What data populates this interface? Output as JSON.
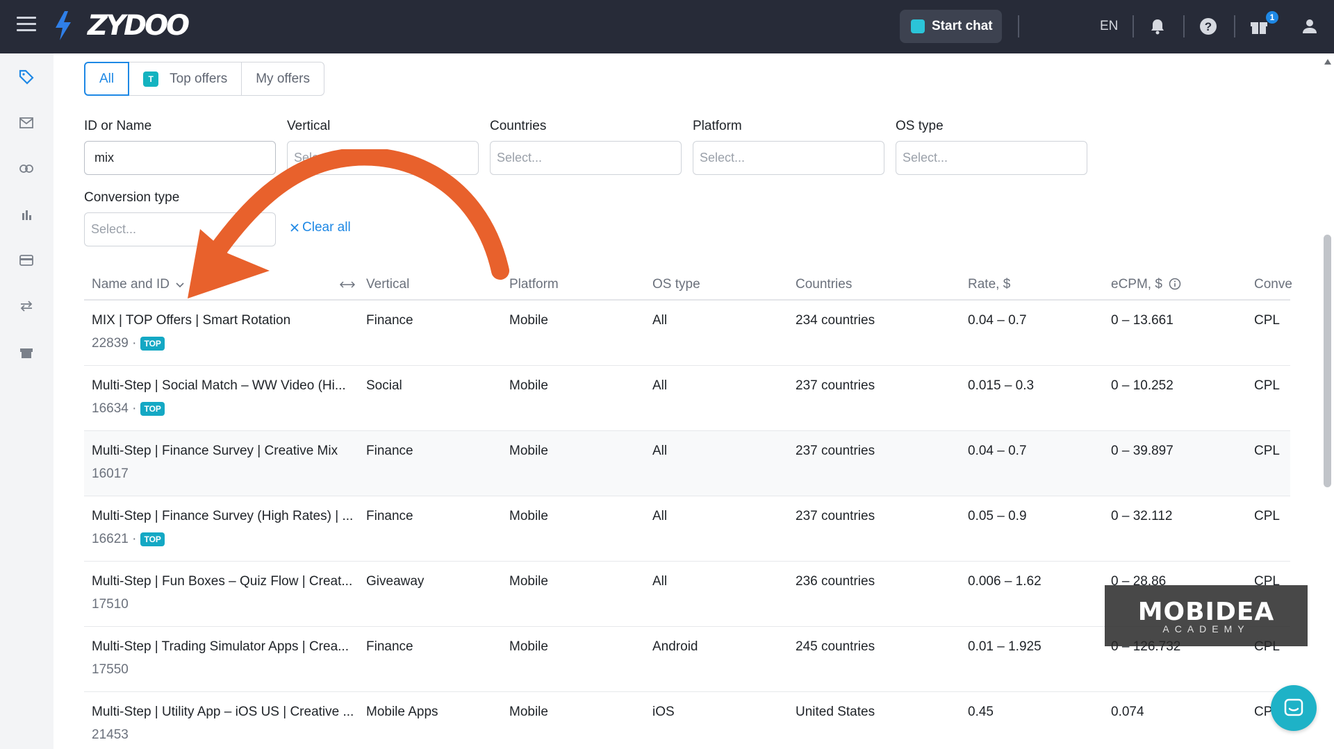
{
  "header": {
    "logo": "ZYDOO",
    "start_chat": "Start chat",
    "lang": "EN",
    "gift_badge": "1"
  },
  "tabs": [
    {
      "label": "All"
    },
    {
      "label": "Top offers",
      "badge": "T"
    },
    {
      "label": "My offers"
    }
  ],
  "filters": {
    "id_name": {
      "label": "ID or Name",
      "value": "mix"
    },
    "vertical": {
      "label": "Vertical",
      "placeholder": "Select..."
    },
    "countries": {
      "label": "Countries",
      "placeholder": "Select..."
    },
    "platform": {
      "label": "Platform",
      "placeholder": "Select..."
    },
    "os_type": {
      "label": "OS type",
      "placeholder": "Select..."
    },
    "conversion_type": {
      "label": "Conversion type",
      "placeholder": "Select..."
    },
    "clear_all": "Clear all"
  },
  "table": {
    "columns": [
      "Name and ID",
      "Vertical",
      "Platform",
      "OS type",
      "Countries",
      "Rate, $",
      "eCPM, $",
      "Conve"
    ],
    "rows": [
      {
        "name": "MIX | TOP Offers | Smart Rotation",
        "id": "22839 ·",
        "top": "TOP",
        "vertical": "Finance",
        "platform": "Mobile",
        "os": "All",
        "countries": "234 countries",
        "rate": "0.04 – 0.7",
        "ecpm": "0 – 13.661",
        "conv": "CPL"
      },
      {
        "name": "Multi-Step | Social Match – WW Video (Hi...",
        "id": "16634 ·",
        "top": "TOP",
        "vertical": "Social",
        "platform": "Mobile",
        "os": "All",
        "countries": "237 countries",
        "rate": "0.015 – 0.3",
        "ecpm": "0 – 10.252",
        "conv": "CPL"
      },
      {
        "name": "Multi-Step | Finance Survey | Creative Mix",
        "id": "16017",
        "top": "",
        "vertical": "Finance",
        "platform": "Mobile",
        "os": "All",
        "countries": "237 countries",
        "rate": "0.04 – 0.7",
        "ecpm": "0 – 39.897",
        "conv": "CPL"
      },
      {
        "name": "Multi-Step | Finance Survey (High Rates) | ...",
        "id": "16621 ·",
        "top": "TOP",
        "vertical": "Finance",
        "platform": "Mobile",
        "os": "All",
        "countries": "237 countries",
        "rate": "0.05 – 0.9",
        "ecpm": "0 – 32.112",
        "conv": "CPL"
      },
      {
        "name": "Multi-Step | Fun Boxes – Quiz Flow | Creat...",
        "id": "17510",
        "top": "",
        "vertical": "Giveaway",
        "platform": "Mobile",
        "os": "All",
        "countries": "236 countries",
        "rate": "0.006 – 1.62",
        "ecpm": "0 – 28.86",
        "conv": "CPL"
      },
      {
        "name": "Multi-Step | Trading Simulator Apps | Crea...",
        "id": "17550",
        "top": "",
        "vertical": "Finance",
        "platform": "Mobile",
        "os": "Android",
        "countries": "245 countries",
        "rate": "0.01 – 1.925",
        "ecpm": "0 – 126.732",
        "conv": "CPL"
      },
      {
        "name": "Multi-Step | Utility App – iOS US | Creative ...",
        "id": "21453",
        "top": "",
        "vertical": "Mobile Apps",
        "platform": "Mobile",
        "os": "iOS",
        "countries": "United States",
        "rate": "0.45",
        "ecpm": "0.074",
        "conv": "CP"
      }
    ]
  },
  "watermark": {
    "main": "MOBIDEA",
    "sub": "ACADEMY"
  },
  "colors": {
    "accent": "#1e88e5",
    "topbar": "#272b38",
    "arrow": "#e8612c",
    "top_tag": "#14a8c4"
  }
}
